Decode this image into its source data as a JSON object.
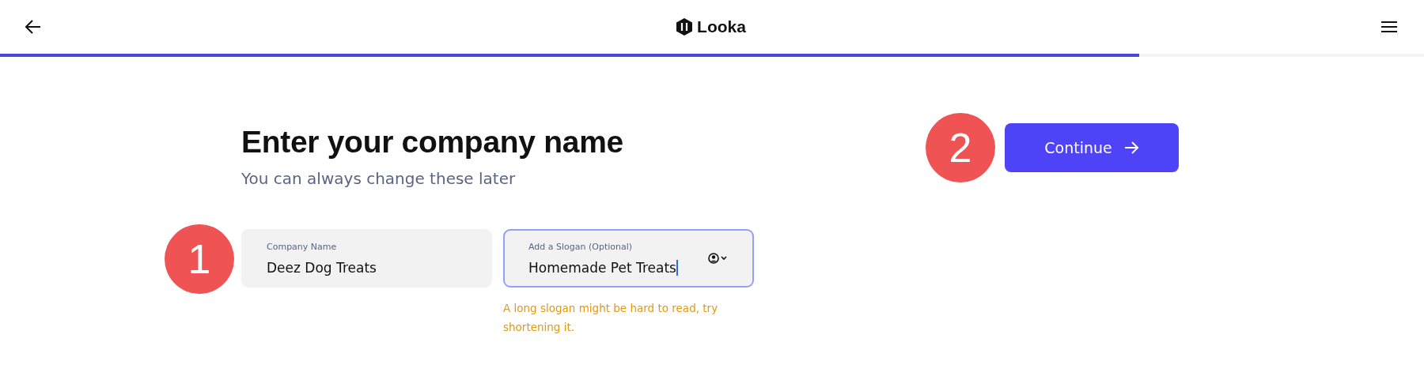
{
  "header": {
    "logo": "Looka"
  },
  "progress": {
    "level": 0.8
  },
  "heading": "Enter your company name",
  "subtitle": "You can always change these later",
  "fields": [
    {
      "label": "Company Name",
      "value": "Deez Dog Treats",
      "focused": false,
      "annotation": "1"
    },
    {
      "label": "Add a Slogan (Optional)",
      "value": "Homemade Pet Treats",
      "focused": true,
      "warning": "A long slogan might be hard to read, try shortening it."
    }
  ],
  "continue_button": {
    "label": "Continue",
    "annotation": "2"
  }
}
